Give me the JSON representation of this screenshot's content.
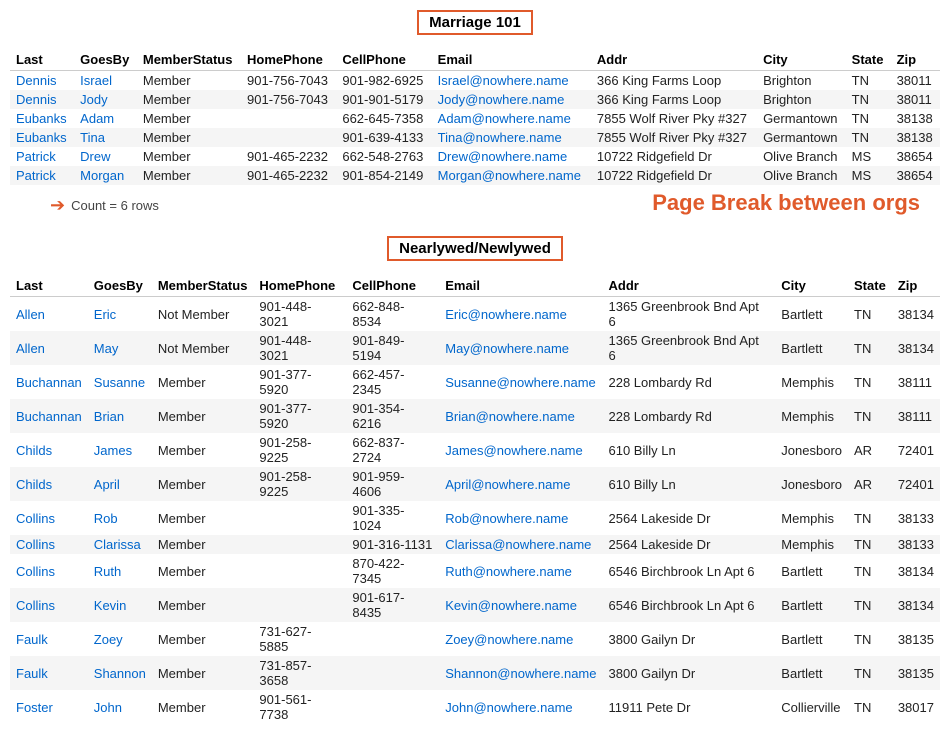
{
  "sections": [
    {
      "title": "Marriage 101",
      "columns": [
        "Last",
        "GoesBy",
        "MemberStatus",
        "HomePhone",
        "CellPhone",
        "Email",
        "Addr",
        "City",
        "State",
        "Zip"
      ],
      "rows": [
        [
          "Dennis",
          "Israel",
          "Member",
          "901-756-7043",
          "901-982-6925",
          "Israel@nowhere.name",
          "366 King Farms Loop",
          "Brighton",
          "TN",
          "38011"
        ],
        [
          "Dennis",
          "Jody",
          "Member",
          "901-756-7043",
          "901-901-5179",
          "Jody@nowhere.name",
          "366 King Farms Loop",
          "Brighton",
          "TN",
          "38011"
        ],
        [
          "Eubanks",
          "Adam",
          "Member",
          "",
          "662-645-7358",
          "Adam@nowhere.name",
          "7855 Wolf River Pky #327",
          "Germantown",
          "TN",
          "38138"
        ],
        [
          "Eubanks",
          "Tina",
          "Member",
          "",
          "901-639-4133",
          "Tina@nowhere.name",
          "7855 Wolf River Pky #327",
          "Germantown",
          "TN",
          "38138"
        ],
        [
          "Patrick",
          "Drew",
          "Member",
          "901-465-2232",
          "662-548-2763",
          "Drew@nowhere.name",
          "10722 Ridgefield Dr",
          "Olive Branch",
          "MS",
          "38654"
        ],
        [
          "Patrick",
          "Morgan",
          "Member",
          "901-465-2232",
          "901-854-2149",
          "Morgan@nowhere.name",
          "10722 Ridgefield Dr",
          "Olive Branch",
          "MS",
          "38654"
        ]
      ],
      "count": "Count = 6 rows"
    },
    {
      "title": "Nearlywed/Newlywed",
      "columns": [
        "Last",
        "GoesBy",
        "MemberStatus",
        "HomePhone",
        "CellPhone",
        "Email",
        "Addr",
        "City",
        "State",
        "Zip"
      ],
      "rows": [
        [
          "Allen",
          "Eric",
          "Not Member",
          "901-448-3021",
          "662-848-8534",
          "Eric@nowhere.name",
          "1365 Greenbrook Bnd Apt 6",
          "Bartlett",
          "TN",
          "38134"
        ],
        [
          "Allen",
          "May",
          "Not Member",
          "901-448-3021",
          "901-849-5194",
          "May@nowhere.name",
          "1365 Greenbrook Bnd Apt 6",
          "Bartlett",
          "TN",
          "38134"
        ],
        [
          "Buchannan",
          "Susanne",
          "Member",
          "901-377-5920",
          "662-457-2345",
          "Susanne@nowhere.name",
          "228 Lombardy Rd",
          "Memphis",
          "TN",
          "38111"
        ],
        [
          "Buchannan",
          "Brian",
          "Member",
          "901-377-5920",
          "901-354-6216",
          "Brian@nowhere.name",
          "228 Lombardy Rd",
          "Memphis",
          "TN",
          "38111"
        ],
        [
          "Childs",
          "James",
          "Member",
          "901-258-9225",
          "662-837-2724",
          "James@nowhere.name",
          "610 Billy Ln",
          "Jonesboro",
          "AR",
          "72401"
        ],
        [
          "Childs",
          "April",
          "Member",
          "901-258-9225",
          "901-959-4606",
          "April@nowhere.name",
          "610 Billy Ln",
          "Jonesboro",
          "AR",
          "72401"
        ],
        [
          "Collins",
          "Rob",
          "Member",
          "",
          "901-335-1024",
          "Rob@nowhere.name",
          "2564 Lakeside Dr",
          "Memphis",
          "TN",
          "38133"
        ],
        [
          "Collins",
          "Clarissa",
          "Member",
          "",
          "901-316-1131",
          "Clarissa@nowhere.name",
          "2564 Lakeside Dr",
          "Memphis",
          "TN",
          "38133"
        ],
        [
          "Collins",
          "Ruth",
          "Member",
          "",
          "870-422-7345",
          "Ruth@nowhere.name",
          "6546 Birchbrook Ln Apt 6",
          "Bartlett",
          "TN",
          "38134"
        ],
        [
          "Collins",
          "Kevin",
          "Member",
          "",
          "901-617-8435",
          "Kevin@nowhere.name",
          "6546 Birchbrook Ln Apt 6",
          "Bartlett",
          "TN",
          "38134"
        ],
        [
          "Faulk",
          "Zoey",
          "Member",
          "731-627-5885",
          "",
          "Zoey@nowhere.name",
          "3800 Gailyn Dr",
          "Bartlett",
          "TN",
          "38135"
        ],
        [
          "Faulk",
          "Shannon",
          "Member",
          "731-857-3658",
          "",
          "Shannon@nowhere.name",
          "3800 Gailyn Dr",
          "Bartlett",
          "TN",
          "38135"
        ],
        [
          "Foster",
          "John",
          "Member",
          "901-561-7738",
          "",
          "John@nowhere.name",
          "11911 Pete Dr",
          "Collierville",
          "TN",
          "38017"
        ]
      ]
    }
  ],
  "pageBreakText": "Page Break between orgs",
  "emailLinkRows": {
    "section0": [
      0,
      1,
      2,
      3,
      4,
      5
    ],
    "section1": [
      0,
      1,
      2,
      3,
      4,
      5,
      6,
      7,
      8,
      9,
      10,
      11,
      12
    ]
  }
}
